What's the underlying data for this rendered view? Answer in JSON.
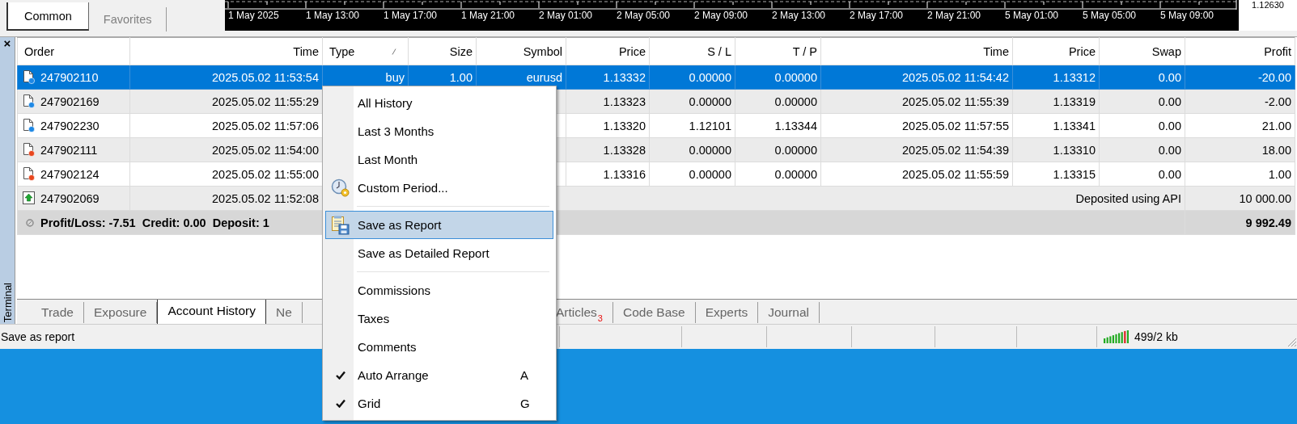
{
  "top_panel": {
    "tabs": [
      {
        "label": "Common",
        "selected": true
      },
      {
        "label": "Favorites",
        "selected": false
      }
    ]
  },
  "chart_axis": {
    "time_labels": [
      "1 May 2025",
      "1 May 13:00",
      "1 May 17:00",
      "1 May 21:00",
      "2 May 01:00",
      "2 May 05:00",
      "2 May 09:00",
      "2 May 13:00",
      "2 May 17:00",
      "2 May 21:00",
      "5 May 01:00",
      "5 May 05:00",
      "5 May 09:00"
    ],
    "price_label": "1.12630"
  },
  "terminal": {
    "close": "×",
    "title": "Terminal",
    "table": {
      "columns": [
        {
          "label": "Order",
          "sorted": false
        },
        {
          "label": "Time",
          "sorted": false
        },
        {
          "label": "Type",
          "sorted": true
        },
        {
          "label": "Size",
          "sorted": false
        },
        {
          "label": "Symbol",
          "sorted": false
        },
        {
          "label": "Price",
          "sorted": false
        },
        {
          "label": "S / L",
          "sorted": false
        },
        {
          "label": "T / P",
          "sorted": false
        },
        {
          "label": "Time",
          "sorted": false
        },
        {
          "label": "Price",
          "sorted": false
        },
        {
          "label": "Swap",
          "sorted": false
        },
        {
          "label": "Profit",
          "sorted": false
        }
      ],
      "rows": [
        {
          "kind": "buy",
          "selected": true,
          "order": "247902110",
          "time": "2025.05.02 11:53:54",
          "type": "buy",
          "size": "1.00",
          "symbol": "eurusd",
          "price": "1.13332",
          "sl": "0.00000",
          "tp": "0.00000",
          "close_time": "2025.05.02 11:54:42",
          "close_price": "1.13312",
          "swap": "0.00",
          "profit": "-20.00"
        },
        {
          "kind": "buy",
          "selected": false,
          "order": "247902169",
          "time": "2025.05.02 11:55:29",
          "price": "1.13323",
          "sl": "0.00000",
          "tp": "0.00000",
          "close_time": "2025.05.02 11:55:39",
          "close_price": "1.13319",
          "swap": "0.00",
          "profit": "-2.00"
        },
        {
          "kind": "buy",
          "selected": false,
          "order": "247902230",
          "time": "2025.05.02 11:57:06",
          "price": "1.13320",
          "sl": "1.12101",
          "tp": "1.13344",
          "close_time": "2025.05.02 11:57:55",
          "close_price": "1.13341",
          "swap": "0.00",
          "profit": "21.00"
        },
        {
          "kind": "sell",
          "selected": false,
          "order": "247902111",
          "time": "2025.05.02 11:54:00",
          "price": "1.13328",
          "sl": "0.00000",
          "tp": "0.00000",
          "close_time": "2025.05.02 11:54:39",
          "close_price": "1.13310",
          "swap": "0.00",
          "profit": "18.00"
        },
        {
          "kind": "sell",
          "selected": false,
          "order": "247902124",
          "time": "2025.05.02 11:55:00",
          "price": "1.13316",
          "sl": "0.00000",
          "tp": "0.00000",
          "close_time": "2025.05.02 11:55:59",
          "close_price": "1.13315",
          "swap": "0.00",
          "profit": "1.00"
        },
        {
          "kind": "deposit",
          "selected": false,
          "order": "247902069",
          "time": "2025.05.02 11:52:08",
          "comment": "Deposited using API",
          "profit": "10 000.00"
        }
      ],
      "summary": {
        "text": "Profit/Loss: -7.51  Credit: 0.00  Deposit: 1",
        "total": "9 992.49"
      }
    },
    "tabs": [
      {
        "label": "Trade",
        "selected": false
      },
      {
        "label": "Exposure",
        "selected": false
      },
      {
        "label": "Account History",
        "selected": true
      },
      {
        "label": "Ne",
        "selected": false
      },
      {
        "label": "Articles",
        "selected": false,
        "badge": "3"
      },
      {
        "label": "Code Base",
        "selected": false
      },
      {
        "label": "Experts",
        "selected": false
      },
      {
        "label": "Journal",
        "selected": false
      }
    ],
    "status_bar": {
      "message": "Save as report",
      "traffic": "499/2 kb"
    }
  },
  "context_menu": {
    "items": [
      {
        "kind": "item",
        "label": "All History",
        "checked": false,
        "highlighted": false
      },
      {
        "kind": "item",
        "label": "Last 3 Months",
        "checked": false,
        "highlighted": false
      },
      {
        "kind": "item",
        "label": "Last Month",
        "checked": false,
        "highlighted": false
      },
      {
        "kind": "item",
        "label": "Custom Period...",
        "checked": false,
        "highlighted": false
      },
      {
        "kind": "separator"
      },
      {
        "kind": "item",
        "label": "Save as Report",
        "checked": false,
        "highlighted": true
      },
      {
        "kind": "item",
        "label": "Save as Detailed Report",
        "checked": false,
        "highlighted": false
      },
      {
        "kind": "separator"
      },
      {
        "kind": "item",
        "label": "Commissions",
        "checked": false,
        "highlighted": false
      },
      {
        "kind": "item",
        "label": "Taxes",
        "checked": false,
        "highlighted": false
      },
      {
        "kind": "item",
        "label": "Comments",
        "checked": false,
        "highlighted": false
      },
      {
        "kind": "item",
        "label": "Auto Arrange",
        "checked": true,
        "highlighted": false,
        "shortcut": "A"
      },
      {
        "kind": "item",
        "label": "Grid",
        "checked": true,
        "highlighted": false,
        "shortcut": "G"
      }
    ]
  }
}
